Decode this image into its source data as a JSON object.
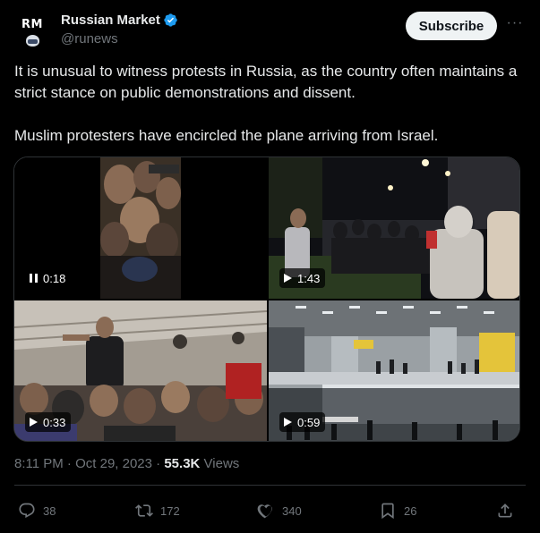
{
  "account": {
    "avatar_text": "RM",
    "display_name": "Russian Market",
    "handle": "@runews",
    "verified_icon": "verified-badge-icon"
  },
  "header": {
    "subscribe_label": "Subscribe",
    "more_label": "···"
  },
  "tweet": {
    "paragraphs": [
      "It is unusual to witness protests in Russia, as the country often maintains a strict stance on public demonstrations and dissent.",
      "Muslim protesters have encircled the plane arriving from Israel."
    ]
  },
  "media": [
    {
      "duration": "0:18",
      "state": "playing",
      "icon": "pause-icon"
    },
    {
      "duration": "1:43",
      "state": "paused",
      "icon": "play-icon"
    },
    {
      "duration": "0:33",
      "state": "paused",
      "icon": "play-icon"
    },
    {
      "duration": "0:59",
      "state": "paused",
      "icon": "play-icon"
    }
  ],
  "meta": {
    "time": "8:11 PM",
    "separator": "·",
    "date": "Oct 29, 2023",
    "views_count": "55.3K",
    "views_label": "Views"
  },
  "actions": {
    "replies": "38",
    "reposts": "172",
    "likes": "340",
    "bookmarks": "26"
  },
  "colors": {
    "background": "#000000",
    "text_primary": "#e7e9ea",
    "text_secondary": "#71767b",
    "verified_blue": "#1d9bf0",
    "divider": "#2f3336",
    "subscribe_bg": "#eff3f4"
  }
}
